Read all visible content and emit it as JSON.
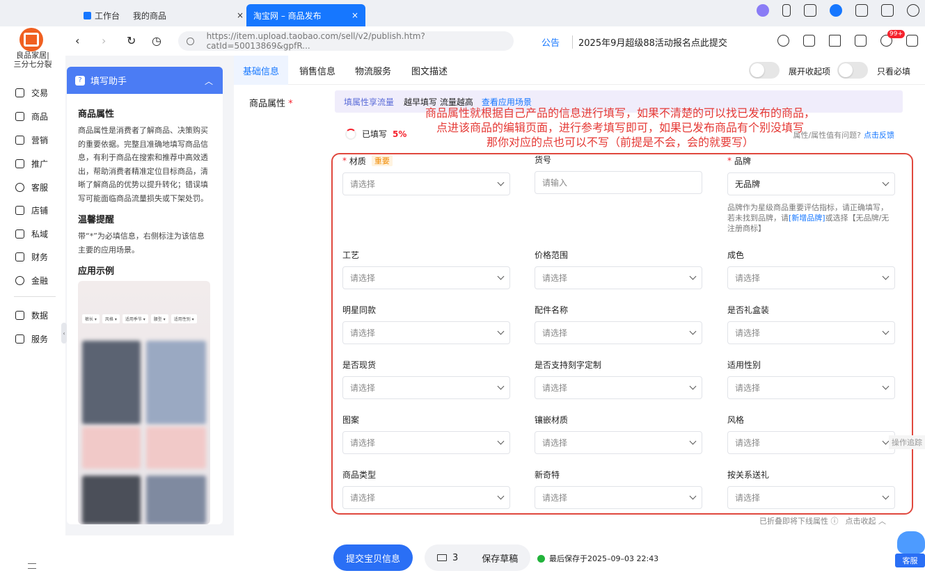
{
  "browser": {
    "tabs": [
      {
        "label": "工作台"
      },
      {
        "label": "我的商品"
      },
      {
        "label": "淘宝网 – 商品发布"
      }
    ],
    "url": "https://item.upload.taobao.com/sell/v2/publish.htm?catId=50013869&gpfR...",
    "notice_label": "公告",
    "notice_text": "2025年9月超级88活动报名点此提交",
    "badge": "99+",
    "close_glyph": "×"
  },
  "shop": {
    "name_line1": "良品家居|",
    "name_line2": "三分七分裂"
  },
  "sidebar": {
    "items": [
      {
        "label": "交易",
        "icon": "receipt-icon"
      },
      {
        "label": "商品",
        "icon": "goods-icon"
      },
      {
        "label": "营销",
        "icon": "ticket-icon"
      },
      {
        "label": "推广",
        "icon": "send-icon"
      },
      {
        "label": "客服",
        "icon": "headset-icon"
      },
      {
        "label": "店铺",
        "icon": "store-icon"
      },
      {
        "label": "私域",
        "icon": "users-icon"
      },
      {
        "label": "财务",
        "icon": "wallet-icon"
      },
      {
        "label": "金融",
        "icon": "finance-icon"
      },
      {
        "label": "数据",
        "icon": "chart-icon"
      },
      {
        "label": "服务",
        "icon": "service-icon"
      }
    ]
  },
  "helper": {
    "title": "填写助手",
    "section1_title": "商品属性",
    "section1_text": "商品属性是消费者了解商品、决策购买的重要依据。完整且准确地填写商品信息，有利于商品在搜索和推荐中高效透出，帮助消费者精准定位目标商品，清晰了解商品的优势以提升转化；错误填写可能面临商品流量损失或下架处罚。",
    "section2_title": "温馨提醒",
    "section2_text": "带“*”为必填信息，右侧标注为该信息主要的应用场景。",
    "section3_title": "应用示例",
    "example_chips": [
      "裤长 ▾",
      "风格 ▾",
      "适用季节 ▾",
      "腰型 ▾",
      "适用性别 ▾"
    ]
  },
  "subtabs": [
    {
      "label": "基础信息"
    },
    {
      "label": "销售信息"
    },
    {
      "label": "物流服务"
    },
    {
      "label": "图文描述"
    }
  ],
  "toggles": {
    "expand_label": "展开收起项",
    "required_only_label": "只看必填"
  },
  "attrs": {
    "section_label": "商品属性",
    "required_mark": "*",
    "promo_tag": "填属性享流量",
    "promo_sub": "越早填写 流量越高",
    "promo_link": "查看应用场景",
    "progress_label": "已填写",
    "progress_value": "5%",
    "feedback_text": "属性/属性值有问题?",
    "feedback_link": "点击反馈",
    "important_tag": "重要",
    "fields": [
      {
        "label": "材质",
        "required": true,
        "value": "请选择",
        "type": "select"
      },
      {
        "label": "货号",
        "required": false,
        "value": "请输入",
        "type": "input"
      },
      {
        "label": "品牌",
        "required": true,
        "value": "无品牌",
        "type": "select"
      },
      {
        "label": "工艺",
        "value": "请选择"
      },
      {
        "label": "价格范围",
        "value": "请选择"
      },
      {
        "label": "成色",
        "value": "请选择"
      },
      {
        "label": "明星同款",
        "value": "请选择"
      },
      {
        "label": "配件名称",
        "value": "请选择"
      },
      {
        "label": "是否礼盒装",
        "value": "请选择"
      },
      {
        "label": "是否现货",
        "value": "请选择"
      },
      {
        "label": "是否支持刻字定制",
        "value": "请选择"
      },
      {
        "label": "适用性别",
        "value": "请选择"
      },
      {
        "label": "图案",
        "value": "请选择"
      },
      {
        "label": "镶嵌材质",
        "value": "请选择"
      },
      {
        "label": "风格",
        "value": "请选择"
      },
      {
        "label": "商品类型",
        "value": "请选择"
      },
      {
        "label": "新奇特",
        "value": "请选择"
      },
      {
        "label": "按关系送礼",
        "value": "请选择"
      }
    ],
    "brand_help_1": "品牌作为星级商品重要评估指标，请正确填写，若未找到品牌，请",
    "brand_help_link": "[新增品牌]",
    "brand_help_2": "或选择【无品牌/无注册商标】",
    "fold_text": "已折叠即将下线属性 ⓘ",
    "fold_link": "点击收起 ︿"
  },
  "annotation": {
    "line1": "商品属性就根据自己产品的信息进行填写，如果不清楚的可以找已发布的商品，",
    "line2": "点进该商品的编辑页面，进行参考填写即可，如果已发布商品有个别没填写",
    "line3": "那你对应的点也可以不写（前提是不会，会的就要写）"
  },
  "op_trace": "操作追踪",
  "bottom": {
    "submit": "提交宝贝信息",
    "draft_count": "3",
    "save_draft": "保存草稿",
    "last_saved": "最后保存于2025–09–03 22:43",
    "service": "客服"
  }
}
